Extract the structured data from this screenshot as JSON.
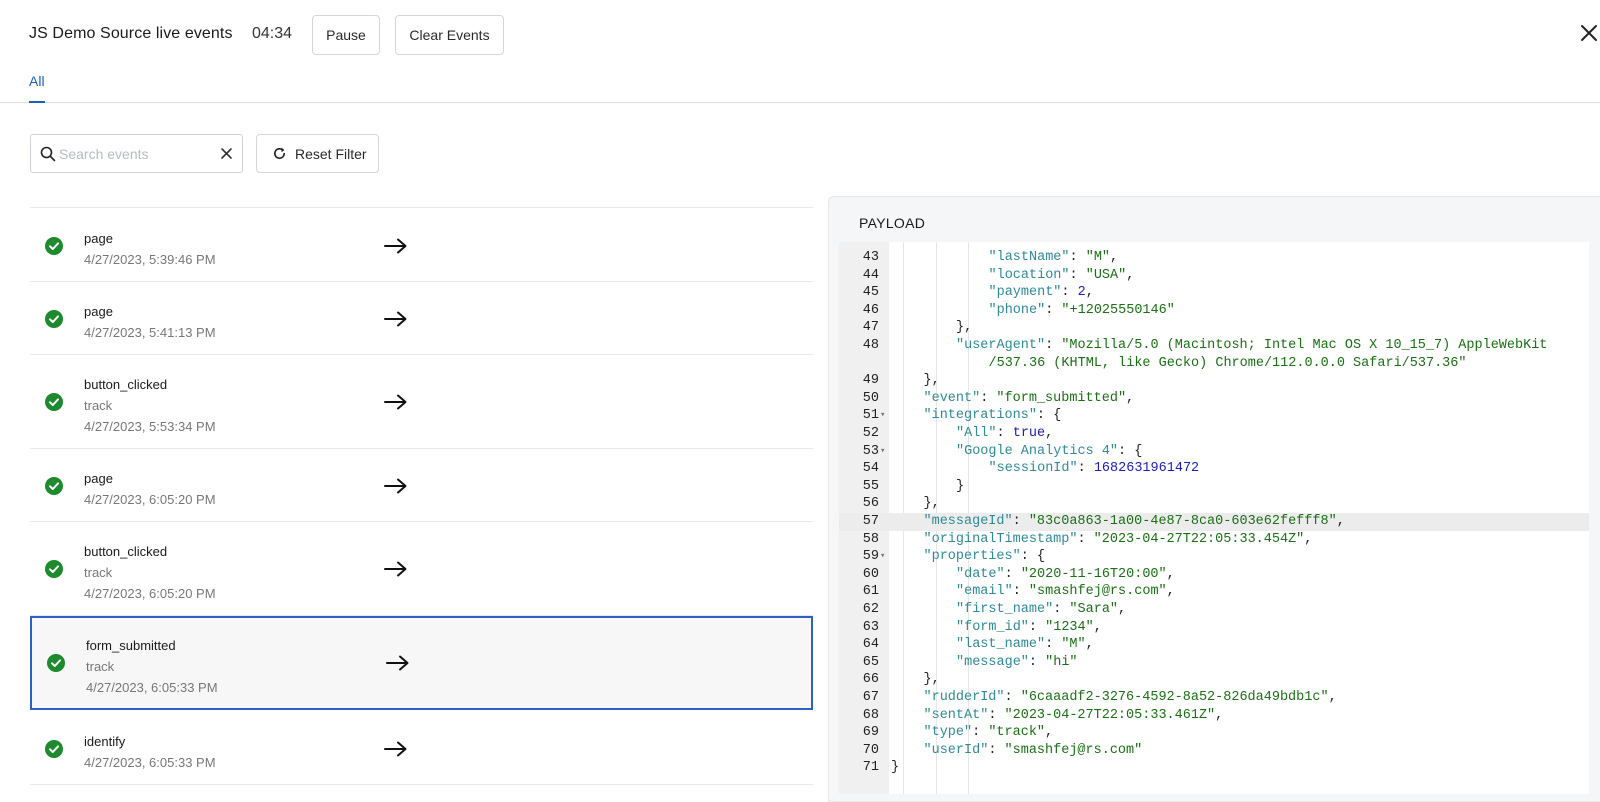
{
  "header": {
    "title": "JS Demo Source live events",
    "timer": "04:34",
    "pause_label": "Pause",
    "clear_label": "Clear Events"
  },
  "tabs": [
    {
      "label": "All",
      "active": true
    }
  ],
  "filter": {
    "search_placeholder": "Search events",
    "search_value": "",
    "reset_label": "Reset Filter"
  },
  "events": [
    {
      "name": "page",
      "type": "",
      "time": "4/27/2023, 5:39:46 PM",
      "selected": false
    },
    {
      "name": "page",
      "type": "",
      "time": "4/27/2023, 5:41:13 PM",
      "selected": false
    },
    {
      "name": "button_clicked",
      "type": "track",
      "time": "4/27/2023, 5:53:34 PM",
      "selected": false
    },
    {
      "name": "page",
      "type": "",
      "time": "4/27/2023, 6:05:20 PM",
      "selected": false
    },
    {
      "name": "button_clicked",
      "type": "track",
      "time": "4/27/2023, 6:05:20 PM",
      "selected": false
    },
    {
      "name": "form_submitted",
      "type": "track",
      "time": "4/27/2023, 6:05:33 PM",
      "selected": true
    },
    {
      "name": "identify",
      "type": "",
      "time": "4/27/2023, 6:05:33 PM",
      "selected": false
    }
  ],
  "payload": {
    "title": "PAYLOAD",
    "highlighted_line": 57,
    "lines": [
      {
        "n": 43,
        "fold": false,
        "indent": 3,
        "k": "lastName",
        "v": "\"M\"",
        "vt": "s",
        "tail": ","
      },
      {
        "n": 44,
        "fold": false,
        "indent": 3,
        "k": "location",
        "v": "\"USA\"",
        "vt": "s",
        "tail": ","
      },
      {
        "n": 45,
        "fold": false,
        "indent": 3,
        "k": "payment",
        "v": "2",
        "vt": "n",
        "tail": ","
      },
      {
        "n": 46,
        "fold": false,
        "indent": 3,
        "k": "phone",
        "v": "\"+12025550146\"",
        "vt": "s",
        "tail": ""
      },
      {
        "n": 47,
        "fold": false,
        "indent": 2,
        "raw": "},"
      },
      {
        "n": 48,
        "fold": false,
        "indent": 2,
        "k": "userAgent",
        "v": "\"Mozilla/5.0 (Macintosh; Intel Mac OS X 10_15_7) AppleWebKit",
        "vt": "s",
        "tail": ""
      },
      {
        "n": null,
        "fold": false,
        "indent": 3,
        "cont": "/537.36 (KHTML, like Gecko) Chrome/112.0.0.0 Safari/537.36\""
      },
      {
        "n": 49,
        "fold": false,
        "indent": 1,
        "raw": "},"
      },
      {
        "n": 50,
        "fold": false,
        "indent": 1,
        "k": "event",
        "v": "\"form_submitted\"",
        "vt": "s",
        "tail": ","
      },
      {
        "n": 51,
        "fold": true,
        "indent": 1,
        "k": "integrations",
        "v": "{",
        "vt": "p",
        "tail": ""
      },
      {
        "n": 52,
        "fold": false,
        "indent": 2,
        "k": "All",
        "v": "true",
        "vt": "b",
        "tail": ","
      },
      {
        "n": 53,
        "fold": true,
        "indent": 2,
        "k": "Google Analytics 4",
        "v": "{",
        "vt": "p",
        "tail": ""
      },
      {
        "n": 54,
        "fold": false,
        "indent": 3,
        "k": "sessionId",
        "v": "1682631961472",
        "vt": "n",
        "tail": ""
      },
      {
        "n": 55,
        "fold": false,
        "indent": 2,
        "raw": "}"
      },
      {
        "n": 56,
        "fold": false,
        "indent": 1,
        "raw": "},"
      },
      {
        "n": 57,
        "fold": false,
        "indent": 1,
        "k": "messageId",
        "v": "\"83c0a863-1a00-4e87-8ca0-603e62fefff8\"",
        "vt": "s",
        "tail": ","
      },
      {
        "n": 58,
        "fold": false,
        "indent": 1,
        "k": "originalTimestamp",
        "v": "\"2023-04-27T22:05:33.454Z\"",
        "vt": "s",
        "tail": ","
      },
      {
        "n": 59,
        "fold": true,
        "indent": 1,
        "k": "properties",
        "v": "{",
        "vt": "p",
        "tail": ""
      },
      {
        "n": 60,
        "fold": false,
        "indent": 2,
        "k": "date",
        "v": "\"2020-11-16T20:00\"",
        "vt": "s",
        "tail": ","
      },
      {
        "n": 61,
        "fold": false,
        "indent": 2,
        "k": "email",
        "v": "\"smashfej@rs.com\"",
        "vt": "s",
        "tail": ","
      },
      {
        "n": 62,
        "fold": false,
        "indent": 2,
        "k": "first_name",
        "v": "\"Sara\"",
        "vt": "s",
        "tail": ","
      },
      {
        "n": 63,
        "fold": false,
        "indent": 2,
        "k": "form_id",
        "v": "\"1234\"",
        "vt": "s",
        "tail": ","
      },
      {
        "n": 64,
        "fold": false,
        "indent": 2,
        "k": "last_name",
        "v": "\"M\"",
        "vt": "s",
        "tail": ","
      },
      {
        "n": 65,
        "fold": false,
        "indent": 2,
        "k": "message",
        "v": "\"hi\"",
        "vt": "s",
        "tail": ""
      },
      {
        "n": 66,
        "fold": false,
        "indent": 1,
        "raw": "},"
      },
      {
        "n": 67,
        "fold": false,
        "indent": 1,
        "k": "rudderId",
        "v": "\"6caaadf2-3276-4592-8a52-826da49bdb1c\"",
        "vt": "s",
        "tail": ","
      },
      {
        "n": 68,
        "fold": false,
        "indent": 1,
        "k": "sentAt",
        "v": "\"2023-04-27T22:05:33.461Z\"",
        "vt": "s",
        "tail": ","
      },
      {
        "n": 69,
        "fold": false,
        "indent": 1,
        "k": "type",
        "v": "\"track\"",
        "vt": "s",
        "tail": ","
      },
      {
        "n": 70,
        "fold": false,
        "indent": 1,
        "k": "userId",
        "v": "\"smashfej@rs.com\"",
        "vt": "s",
        "tail": ""
      },
      {
        "n": 71,
        "fold": false,
        "indent": 0,
        "raw": "}"
      }
    ]
  },
  "colors": {
    "accent": "#1a5fc7",
    "success": "#1e8a2e",
    "json_key": "#2f8a96",
    "json_string": "#1b6f15",
    "json_number": "#1c1cb8"
  }
}
